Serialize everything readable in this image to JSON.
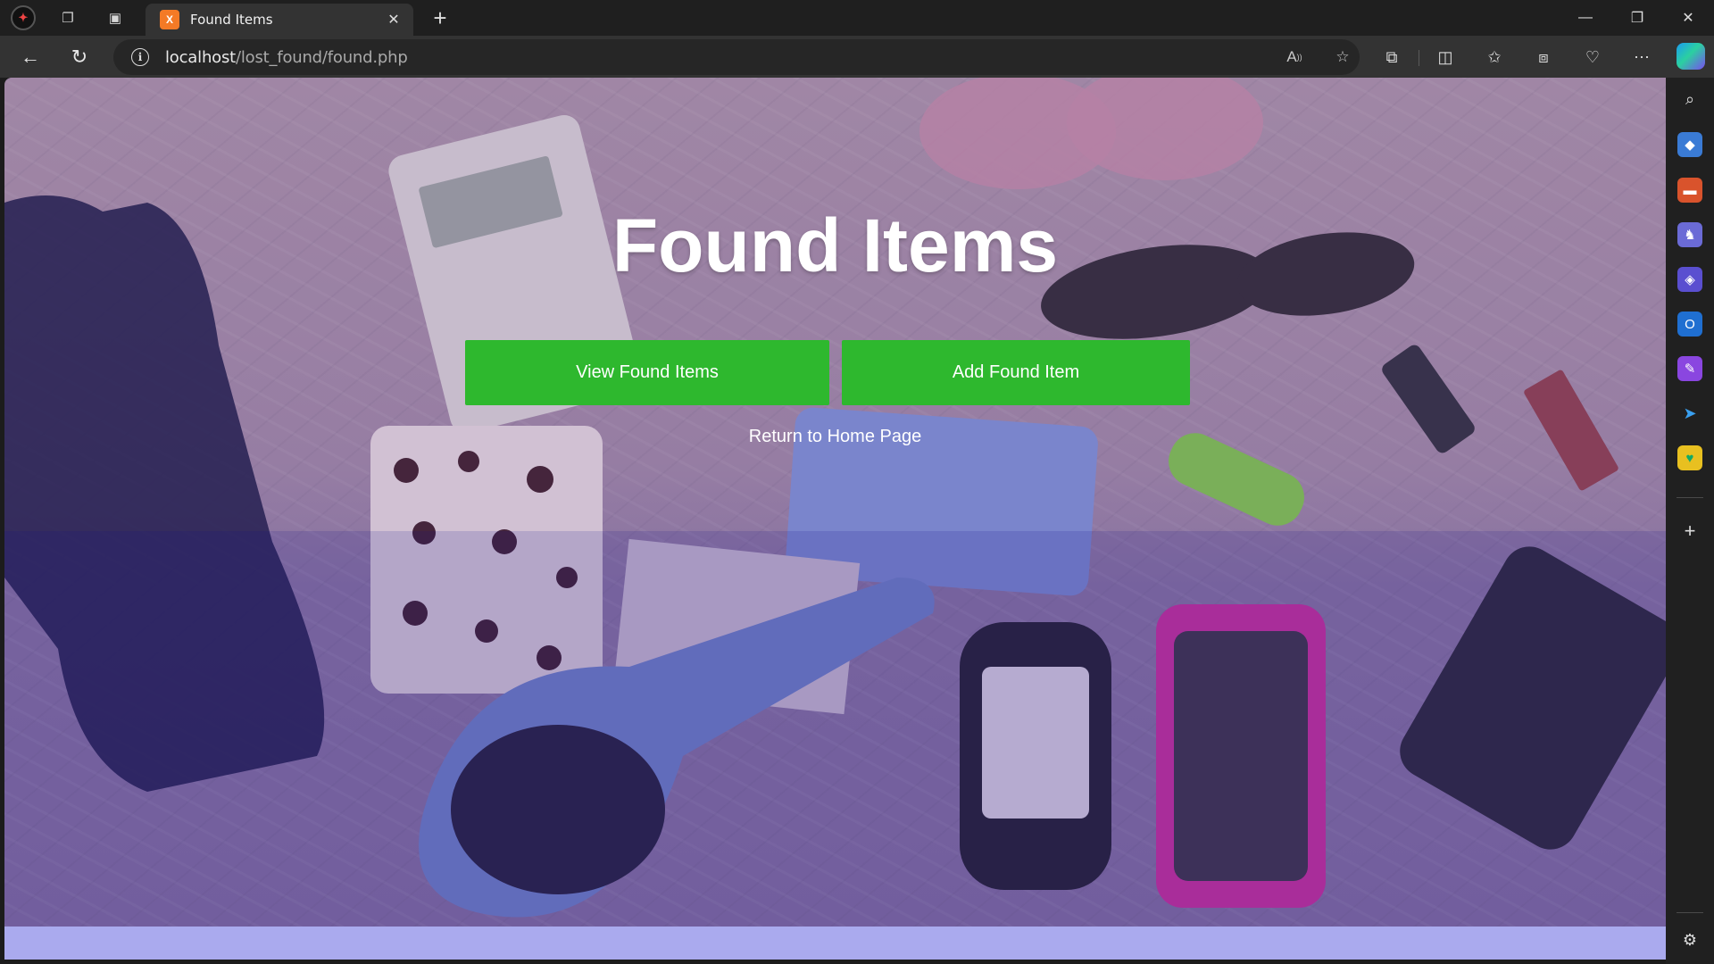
{
  "browser": {
    "tab": {
      "title": "Found Items",
      "favicon_text": "X"
    },
    "address": {
      "host": "localhost",
      "path": "/lost_found/found.php"
    },
    "accent": "#f47a26"
  },
  "page": {
    "title": "Found Items",
    "buttons": {
      "view_label": "View Found Items",
      "add_label": "Add Found Item"
    },
    "home_link": "Return to Home Page",
    "button_color": "#2eb82e",
    "footer_color": "#aaaaee"
  }
}
